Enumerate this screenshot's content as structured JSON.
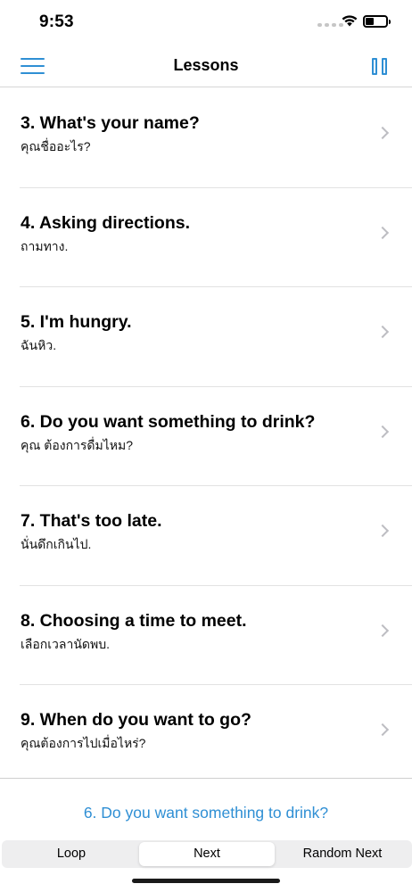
{
  "status_bar": {
    "time": "9:53",
    "icons": [
      "cellular-signal-icon",
      "wifi-icon",
      "battery-icon"
    ]
  },
  "nav_bar": {
    "title": "Lessons",
    "left_icon": "hamburger-menu-icon",
    "right_icon": "pause-icon"
  },
  "lessons": [
    {
      "title": "3. What's your name?",
      "subtitle": "คุณชื่ออะไร?"
    },
    {
      "title": "4. Asking directions.",
      "subtitle": "ถามทาง."
    },
    {
      "title": "5. I'm hungry.",
      "subtitle": "ฉันหิว."
    },
    {
      "title": "6. Do you want something to drink?",
      "subtitle": "คุณ ต้องการดื่มไหม?"
    },
    {
      "title": "7. That's too late.",
      "subtitle": "นั่นดึกเกินไป."
    },
    {
      "title": "8. Choosing a time to meet.",
      "subtitle": "เลือกเวลานัดพบ."
    },
    {
      "title": "9. When do you want to go?",
      "subtitle": "คุณต้องการไปเมื่อไหร่?"
    }
  ],
  "now_playing": {
    "title": "6. Do you want something to drink?"
  },
  "playback_modes": {
    "options": [
      "Loop",
      "Next",
      "Random Next"
    ],
    "selected": "Next"
  },
  "colors": {
    "accent": "#2f8fd4",
    "separator": "#e2e2e2",
    "chevron": "#bdbdc2"
  }
}
